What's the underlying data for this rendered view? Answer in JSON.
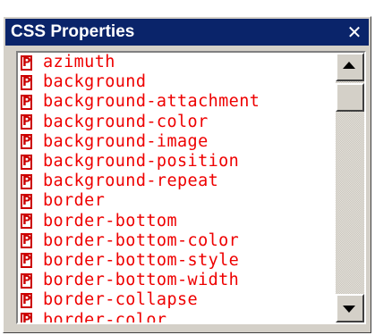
{
  "window": {
    "title": "CSS Properties",
    "close_glyph": "✕"
  },
  "list": {
    "badge_letter": "P",
    "badge_icon": "property-icon",
    "items": [
      "azimuth",
      "background",
      "background-attachment",
      "background-color",
      "background-image",
      "background-position",
      "background-repeat",
      "border",
      "border-bottom",
      "border-bottom-color",
      "border-bottom-style",
      "border-bottom-width",
      "border-collapse",
      "border-color"
    ]
  },
  "scrollbar": {
    "up_icon": "arrow-up-icon",
    "down_icon": "arrow-down-icon",
    "position_fraction": 0.0
  },
  "colors": {
    "titlebar": "#0a246a",
    "item_text": "#ee0000",
    "badge": "#cc0000"
  }
}
